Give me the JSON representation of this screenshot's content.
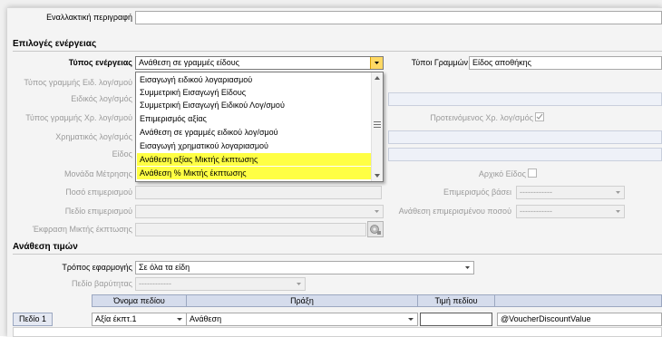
{
  "top": {
    "alt_description_label": "Εναλλακτική περιγραφή",
    "alt_description_value": ""
  },
  "action_options": {
    "section_title": "Επιλογές ενέργειας",
    "action_type_label": "Τύπος ενέργειας",
    "action_type_value": "Ανάθεση σε γραμμές είδους",
    "line_types_label": "Τύποι Γραμμών",
    "line_types_value": "Είδος αποθήκης",
    "special_account_line_type_label": "Τύπος γραμμής Ειδ. λογ/σμού",
    "special_account_label": "Ειδικός λογ/σμός",
    "financial_account_line_type_label": "Τύπος γραμμής Χρ. λογ/σμού",
    "financial_account_label": "Χρηματικός λογ/σμός",
    "item_label": "Είδος",
    "unit_label": "Μονάδα Μέτρησης",
    "allocation_amount_label": "Ποσό επιμερισμού",
    "allocation_field_label": "Πεδίο επιμερισμού",
    "discount_expression_label": "Έκφραση Μικτής έκπτωσης",
    "preferred_financial_label": "Προτεινόμενος Χρ. λογ/σμός",
    "initial_item_label": "Αρχικό Είδος",
    "allocation_basis_label": "Επιμερισμός βάσει",
    "allocation_basis_value": "------------",
    "assign_allocated_amount_label": "Ανάθεση επιμερισμένου ποσού",
    "assign_allocated_amount_value": "------------"
  },
  "dropdown": {
    "items": [
      {
        "label": "Εισαγωγή ειδικού λογαριασμού",
        "highlighted": false
      },
      {
        "label": "Συμμετρική Εισαγωγή Είδους",
        "highlighted": false
      },
      {
        "label": "Συμμετρική Εισαγωγή Ειδικού Λογ/σμού",
        "highlighted": false
      },
      {
        "label": "Επιμερισμός αξίας",
        "highlighted": false
      },
      {
        "label": "Ανάθεση σε γραμμές ειδικού λογ/σμού",
        "highlighted": false
      },
      {
        "label": "Εισαγωγή χρηματικού λογαριασμού",
        "highlighted": false
      },
      {
        "label": "Ανάθεση αξίας Μικτής έκπτωσης",
        "highlighted": true
      },
      {
        "label": "Ανάθεση % Μικτής έκπτωσης",
        "highlighted": true
      }
    ],
    "highlight_color": "#ffff44"
  },
  "value_assignment": {
    "section_title": "Ανάθεση τιμών",
    "apply_mode_label": "Τρόπος εφαρμογής",
    "apply_mode_value": "Σε όλα τα είδη",
    "weight_field_label": "Πεδίο βαρύτητας",
    "weight_field_value": "------------"
  },
  "grid": {
    "headers": [
      "Όνομα πεδίου",
      "Πράξη",
      "Τιμή πεδίου"
    ],
    "rows": [
      {
        "row_label": "Πεδίο 1",
        "field_name": "Αξία έκπτ.1",
        "operation": "Ανάθεση",
        "field_value": "",
        "expression": "@VoucherDiscountValue"
      }
    ]
  },
  "colors": {
    "header_fill": "#d5dcec",
    "panel": "#f4f4f4"
  }
}
